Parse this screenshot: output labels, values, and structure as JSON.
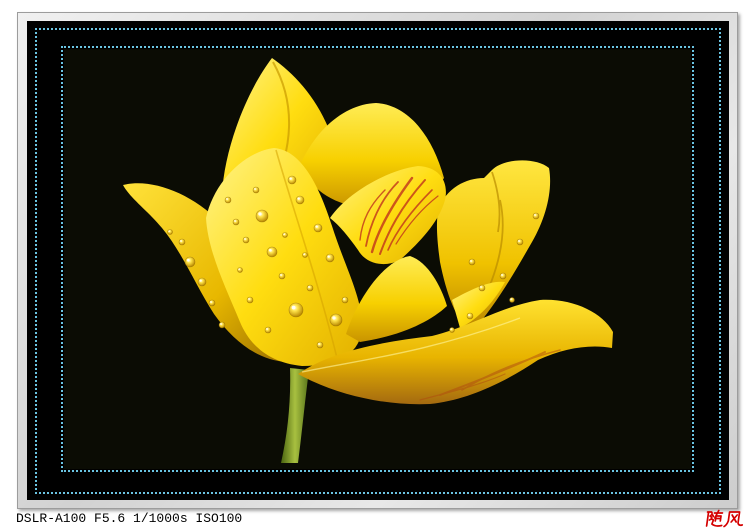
{
  "caption": "DSLR-A100 F5.6 1/1000s ISO100",
  "signature": "随风",
  "colors": {
    "page_background": "#ffffff",
    "mat": "#000000",
    "frame_lines": "#6ac4e2",
    "photo_background": "#0b0c04",
    "caption": "#000000",
    "signature": "#d40000",
    "petals": "#f7d000",
    "stem": "#7f9c2c"
  }
}
